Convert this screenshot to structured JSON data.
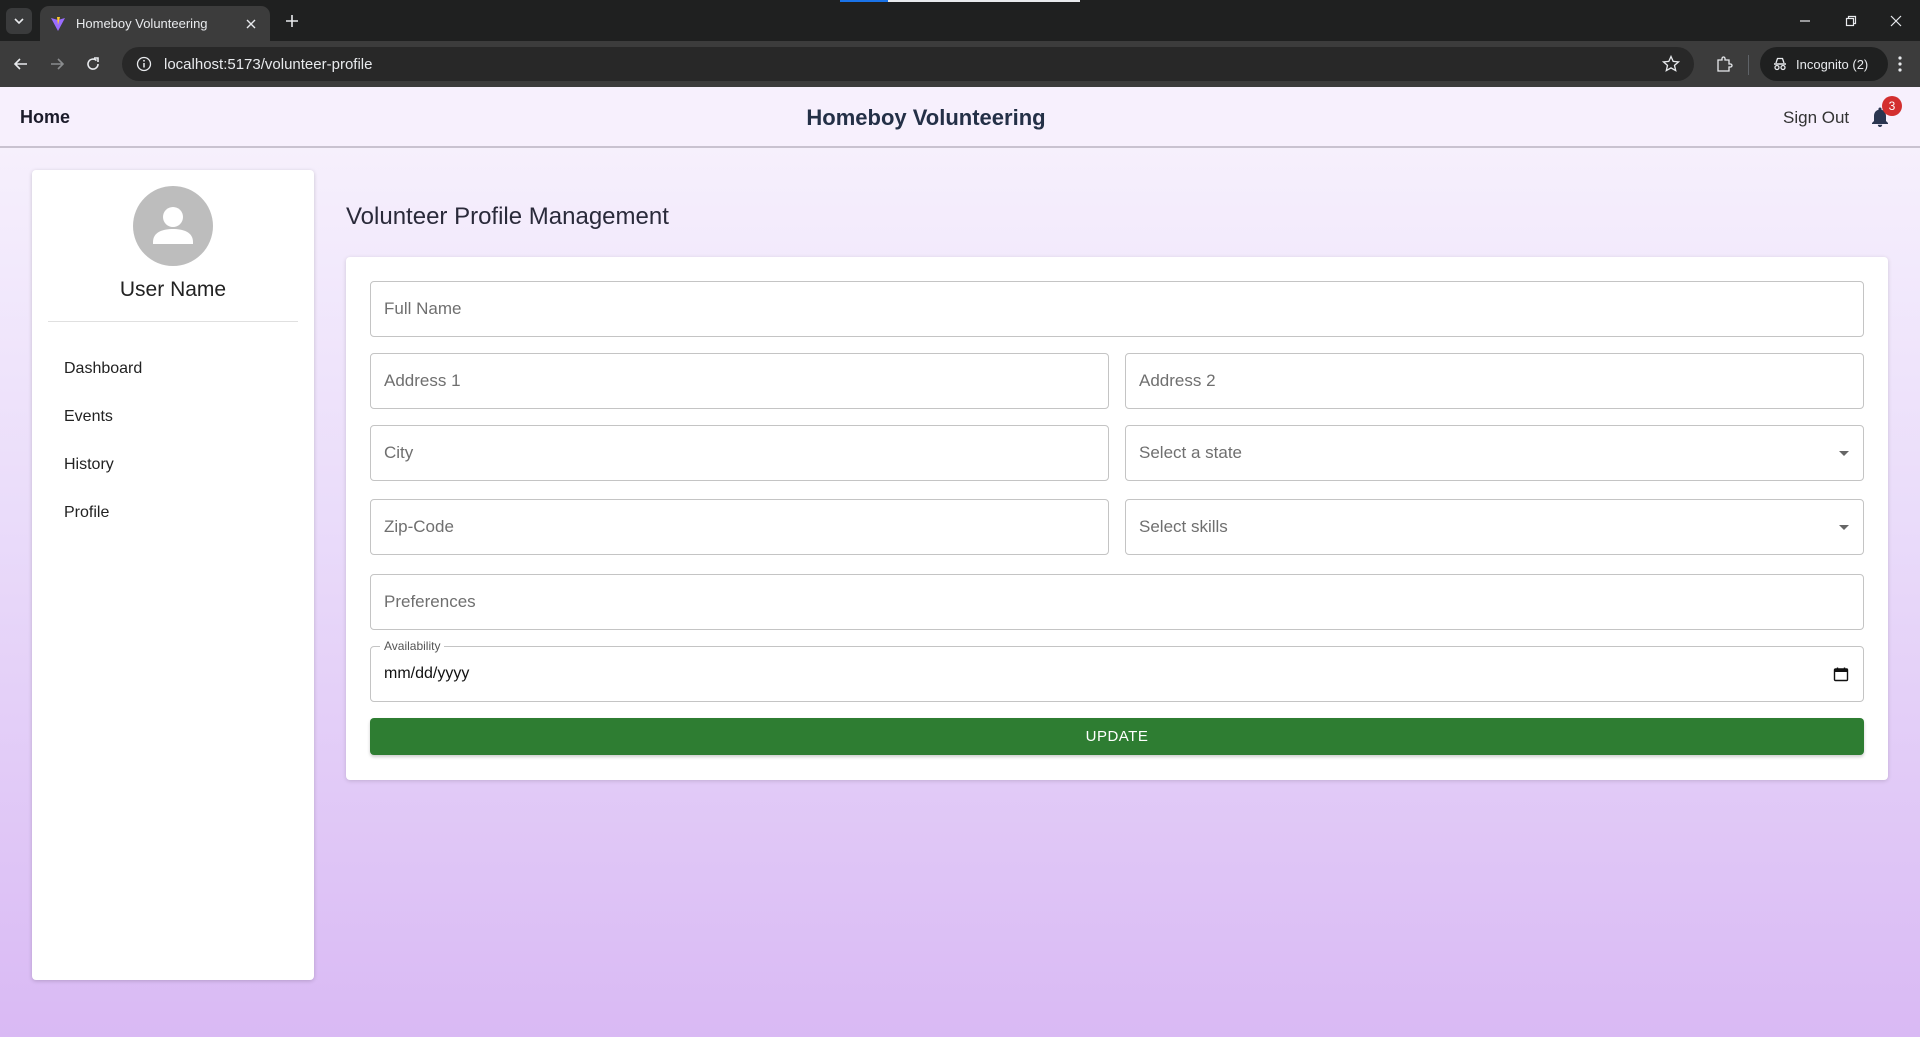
{
  "browser": {
    "tab_title": "Homeboy Volunteering",
    "url": "localhost:5173/volunteer-profile",
    "incognito_label": "Incognito (2)"
  },
  "header": {
    "home_label": "Home",
    "app_title": "Homeboy Volunteering",
    "sign_out_label": "Sign Out",
    "notification_count": "3"
  },
  "sidebar": {
    "user_name": "User Name",
    "items": [
      {
        "label": "Dashboard"
      },
      {
        "label": "Events"
      },
      {
        "label": "History"
      },
      {
        "label": "Profile"
      }
    ]
  },
  "main": {
    "heading": "Volunteer Profile Management",
    "form": {
      "full_name_placeholder": "Full Name",
      "address1_placeholder": "Address 1",
      "address2_placeholder": "Address 2",
      "city_placeholder": "City",
      "state_placeholder": "Select a state",
      "zip_placeholder": "Zip-Code",
      "skills_placeholder": "Select skills",
      "preferences_placeholder": "Preferences",
      "availability_label": "Availability",
      "availability_value": "mm/dd/yyyy",
      "update_label": "UPDATE"
    }
  },
  "colors": {
    "accent_green": "#2e7d32",
    "badge_red": "#d32f2f",
    "background_start": "#f8f3fd",
    "background_end": "#d9b9f4"
  }
}
